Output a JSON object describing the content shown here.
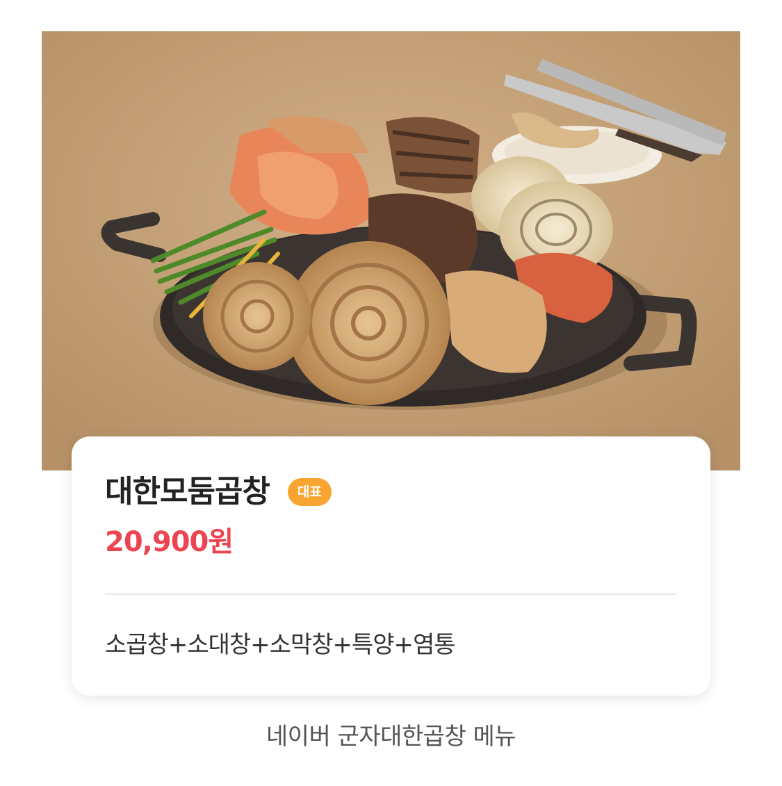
{
  "photo": {
    "alt_icon": "grilled-gopchang-platter-photo"
  },
  "card": {
    "menu_name": "대한모둠곱창",
    "badge": "대표",
    "price": "20,900원",
    "description": "소곱창+소대창+소막창+특양+염통"
  },
  "caption": "네이버 군자대한곱창 메뉴",
  "colors": {
    "price": "#ec4552",
    "badge_bg": "#f7a530",
    "title": "#222222",
    "background_photo": "#c4a074"
  }
}
